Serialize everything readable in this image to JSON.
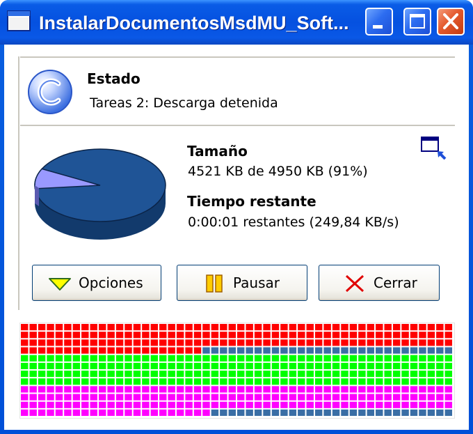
{
  "window": {
    "title": "InstalarDocumentosMsdMU_Soft..."
  },
  "status": {
    "heading": "Estado",
    "text": "Tareas 2: Descarga detenida"
  },
  "size": {
    "heading": "Tamaño",
    "text": "4521 KB de 4950 KB (91%)"
  },
  "time": {
    "heading": "Tiempo restante",
    "text": "0:00:01 restantes (249,84 KB/s)"
  },
  "progress": {
    "fraction_complete": 0.91
  },
  "buttons": {
    "options": "Opciones",
    "pause": "Pausar",
    "close": "Cerrar"
  },
  "segments": {
    "columns": 50,
    "rows": [
      [
        "#ff0000",
        50,
        null,
        0
      ],
      [
        "#ff0000",
        50,
        null,
        0
      ],
      [
        "#ff0000",
        50,
        null,
        0
      ],
      [
        "#ff0000",
        21,
        "#3a6ea5",
        29
      ],
      [
        "#00ff00",
        50,
        null,
        0
      ],
      [
        "#00ff00",
        50,
        null,
        0
      ],
      [
        "#00ff00",
        50,
        null,
        0
      ],
      [
        "#00ff00",
        50,
        null,
        0
      ],
      [
        "#ff00ff",
        50,
        null,
        0
      ],
      [
        "#ff00ff",
        50,
        null,
        0
      ],
      [
        "#ff00ff",
        50,
        null,
        0
      ],
      [
        "#ff00ff",
        22,
        "#3a6ea5",
        28
      ]
    ]
  },
  "colors": {
    "pie_remaining": "#1f5496",
    "pie_complete": "#9999ff",
    "title_blue": "#0a58e6"
  }
}
